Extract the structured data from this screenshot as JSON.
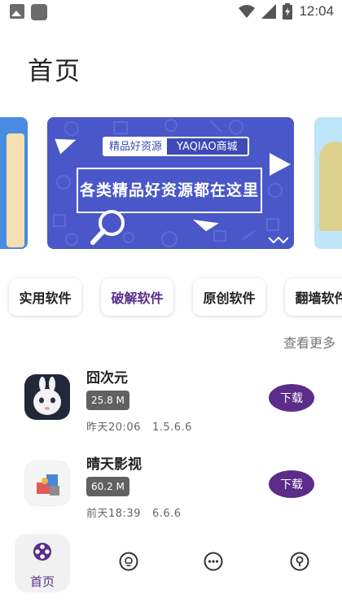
{
  "status_bar": {
    "time": "12:04",
    "icons": [
      "image-icon",
      "app-square-icon",
      "wifi-icon",
      "signal-icon",
      "battery-icon"
    ]
  },
  "page_title": "首页",
  "banner": {
    "tag_left": "精品好资源",
    "tag_right": "YAQIAO商城",
    "headline": "各类精品好资源都在这里"
  },
  "categories": [
    {
      "label": "实用软件",
      "active": false
    },
    {
      "label": "破解软件",
      "active": true
    },
    {
      "label": "原创软件",
      "active": false
    },
    {
      "label": "翻墙软件",
      "active": false
    }
  ],
  "see_more": "查看更多",
  "apps": [
    {
      "name": "囧次元",
      "size": "25.8 M",
      "date": "昨天20:06",
      "version": "1.5.6.6",
      "action": "下载",
      "icon": "rabbit-icon"
    },
    {
      "name": "晴天影视",
      "size": "60.2 M",
      "date": "前天18:39",
      "version": "6.6.6",
      "action": "下载",
      "icon": "puzzle-icon"
    }
  ],
  "bottom_nav": [
    {
      "label": "首页",
      "icon": "home-film-reel-icon",
      "active": true
    },
    {
      "label": "",
      "icon": "bulb-icon",
      "active": false
    },
    {
      "label": "",
      "icon": "more-dots-icon",
      "active": false
    },
    {
      "label": "",
      "icon": "profile-icon",
      "active": false
    }
  ],
  "colors": {
    "accent": "#5b2c8a",
    "banner": "#4a57c8",
    "size_badge": "#616161"
  }
}
